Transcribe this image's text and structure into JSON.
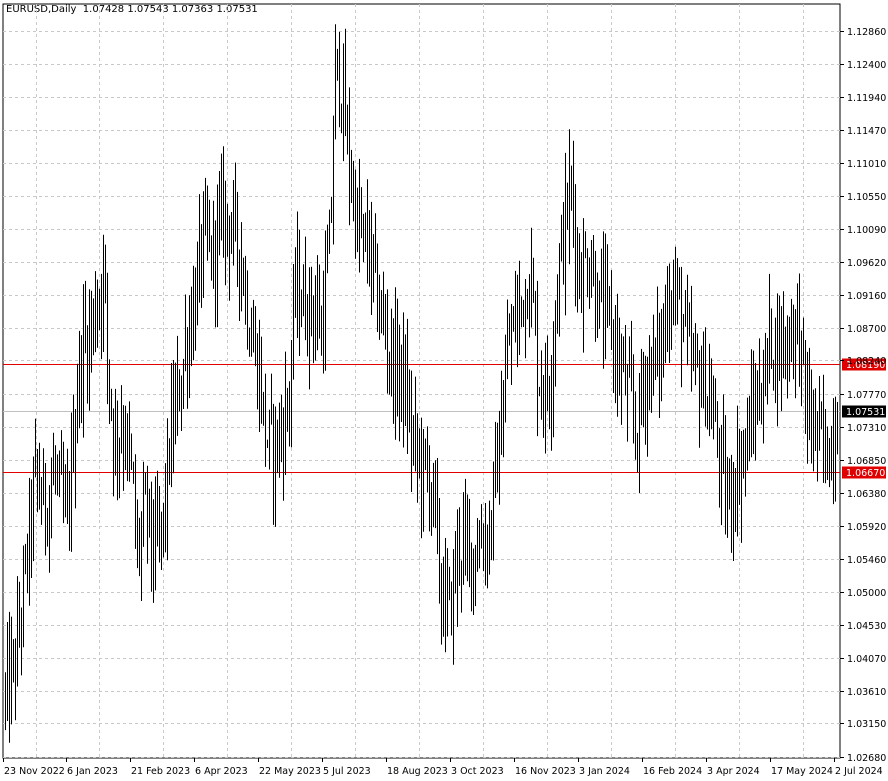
{
  "header": {
    "symbol": "EURUSD,Daily",
    "open": "1.07428",
    "high": "1.07543",
    "low": "1.07363",
    "close": "1.07531"
  },
  "colors": {
    "background": "#ffffff",
    "grid": "#c8c8c8",
    "bars": "#000000",
    "level_lines": "#e00000",
    "current_price_line": "#c0c0c0",
    "current_price_tag": "#000000"
  },
  "chart_data": {
    "type": "bar",
    "style": "OHLC daily bars",
    "grid": true,
    "ylim": [
      1.0268,
      1.2905
    ],
    "y_ticks": [
      "1.12860",
      "1.12400",
      "1.11940",
      "1.11470",
      "1.11010",
      "1.10550",
      "1.10090",
      "1.09620",
      "1.09160",
      "1.08700",
      "1.08240",
      "1.07770",
      "1.07310",
      "1.06850",
      "1.06380",
      "1.05920",
      "1.05460",
      "1.05000",
      "1.04530",
      "1.04070",
      "1.03610",
      "1.03150",
      "1.02680"
    ],
    "x_ticks": [
      "23 Nov 2022",
      "6 Jan 2023",
      "21 Feb 2023",
      "6 Apr 2023",
      "22 May 2023",
      "5 Jul 2023",
      "18 Aug 2023",
      "3 Oct 2023",
      "16 Nov 2023",
      "3 Jan 2024",
      "16 Feb 2024",
      "3 Apr 2024",
      "17 May 2024",
      "2 Jul 2024"
    ],
    "horizontal_levels": [
      {
        "value": 1.0819,
        "label": "1.08190"
      },
      {
        "value": 1.0667,
        "label": "1.06670"
      }
    ],
    "current_price": {
      "value": 1.07531,
      "label": "1.07531"
    },
    "approx_daily_path": [
      [
        "23 Nov 2022",
        1.035
      ],
      [
        "30 Nov 2022",
        1.04
      ],
      [
        "7 Dec 2022",
        1.052
      ],
      [
        "14 Dec 2022",
        1.066
      ],
      [
        "21 Dec 2022",
        1.062
      ],
      [
        "28 Dec 2022",
        1.067
      ],
      [
        "4 Jan 2023",
        1.06
      ],
      [
        "6 Jan 2023",
        1.06
      ],
      [
        "11 Jan 2023",
        1.074
      ],
      [
        "16 Jan 2023",
        1.084
      ],
      [
        "20 Jan 2023",
        1.085
      ],
      [
        "25 Jan 2023",
        1.089
      ],
      [
        "1 Feb 2023",
        1.095
      ],
      [
        "3 Feb 2023",
        1.083
      ],
      [
        "8 Feb 2023",
        1.071
      ],
      [
        "14 Feb 2023",
        1.074
      ],
      [
        "21 Feb 2023",
        1.065
      ],
      [
        "24 Feb 2023",
        1.055
      ],
      [
        "3 Mar 2023",
        1.062
      ],
      [
        "8 Mar 2023",
        1.055
      ],
      [
        "15 Mar 2023",
        1.06
      ],
      [
        "20 Mar 2023",
        1.072
      ],
      [
        "24 Mar 2023",
        1.076
      ],
      [
        "31 Mar 2023",
        1.085
      ],
      [
        "6 Apr 2023",
        1.091
      ],
      [
        "12 Apr 2023",
        1.099
      ],
      [
        "18 Apr 2023",
        1.097
      ],
      [
        "26 Apr 2023",
        1.103
      ],
      [
        "2 May 2023",
        1.101
      ],
      [
        "8 May 2023",
        1.098
      ],
      [
        "15 May 2023",
        1.087
      ],
      [
        "22 May 2023",
        1.08
      ],
      [
        "26 May 2023",
        1.072
      ],
      [
        "31 May 2023",
        1.07
      ],
      [
        "6 Jun 2023",
        1.072
      ],
      [
        "12 Jun 2023",
        1.078
      ],
      [
        "16 Jun 2023",
        1.093
      ],
      [
        "23 Jun 2023",
        1.09
      ],
      [
        "29 Jun 2023",
        1.09
      ],
      [
        "5 Jul 2023",
        1.087
      ],
      [
        "11 Jul 2023",
        1.1
      ],
      [
        "14 Jul 2023",
        1.123
      ],
      [
        "18 Jul 2023",
        1.122
      ],
      [
        "24 Jul 2023",
        1.11
      ],
      [
        "31 Jul 2023",
        1.1
      ],
      [
        "7 Aug 2023",
        1.098
      ],
      [
        "14 Aug 2023",
        1.09
      ],
      [
        "18 Aug 2023",
        1.087
      ],
      [
        "24 Aug 2023",
        1.082
      ],
      [
        "31 Aug 2023",
        1.08
      ],
      [
        "7 Sep 2023",
        1.071
      ],
      [
        "14 Sep 2023",
        1.067
      ],
      [
        "21 Sep 2023",
        1.065
      ],
      [
        "27 Sep 2023",
        1.05
      ],
      [
        "3 Oct 2023",
        1.047
      ],
      [
        "10 Oct 2023",
        1.057
      ],
      [
        "17 Oct 2023",
        1.055
      ],
      [
        "24 Oct 2023",
        1.057
      ],
      [
        "31 Oct 2023",
        1.058
      ],
      [
        "7 Nov 2023",
        1.07
      ],
      [
        "14 Nov 2023",
        1.085
      ],
      [
        "16 Nov 2023",
        1.086
      ],
      [
        "22 Nov 2023",
        1.09
      ],
      [
        "29 Nov 2023",
        1.095
      ],
      [
        "5 Dec 2023",
        1.08
      ],
      [
        "12 Dec 2023",
        1.078
      ],
      [
        "19 Dec 2023",
        1.095
      ],
      [
        "28 Dec 2023",
        1.107
      ],
      [
        "3 Jan 2024",
        1.094
      ],
      [
        "10 Jan 2024",
        1.097
      ],
      [
        "17 Jan 2024",
        1.09
      ],
      [
        "24 Jan 2024",
        1.088
      ],
      [
        "31 Jan 2024",
        1.082
      ],
      [
        "7 Feb 2024",
        1.077
      ],
      [
        "13 Feb 2024",
        1.072
      ],
      [
        "16 Feb 2024",
        1.078
      ],
      [
        "22 Feb 2024",
        1.082
      ],
      [
        "29 Feb 2024",
        1.083
      ],
      [
        "7 Mar 2024",
        1.093
      ],
      [
        "14 Mar 2024",
        1.09
      ],
      [
        "21 Mar 2024",
        1.082
      ],
      [
        "28 Mar 2024",
        1.08
      ],
      [
        "3 Apr 2024",
        1.078
      ],
      [
        "10 Apr 2024",
        1.07
      ],
      [
        "16 Apr 2024",
        1.062
      ],
      [
        "22 Apr 2024",
        1.066
      ],
      [
        "29 Apr 2024",
        1.07
      ],
      [
        "6 May 2024",
        1.076
      ],
      [
        "13 May 2024",
        1.08
      ],
      [
        "17 May 2024",
        1.086
      ],
      [
        "23 May 2024",
        1.084
      ],
      [
        "30 May 2024",
        1.086
      ],
      [
        "5 Jun 2024",
        1.088
      ],
      [
        "12 Jun 2024",
        1.075
      ],
      [
        "19 Jun 2024",
        1.072
      ],
      [
        "26 Jun 2024",
        1.069
      ],
      [
        "2 Jul 2024",
        1.074
      ],
      [
        "4 Jul 2024",
        1.0753
      ]
    ]
  }
}
